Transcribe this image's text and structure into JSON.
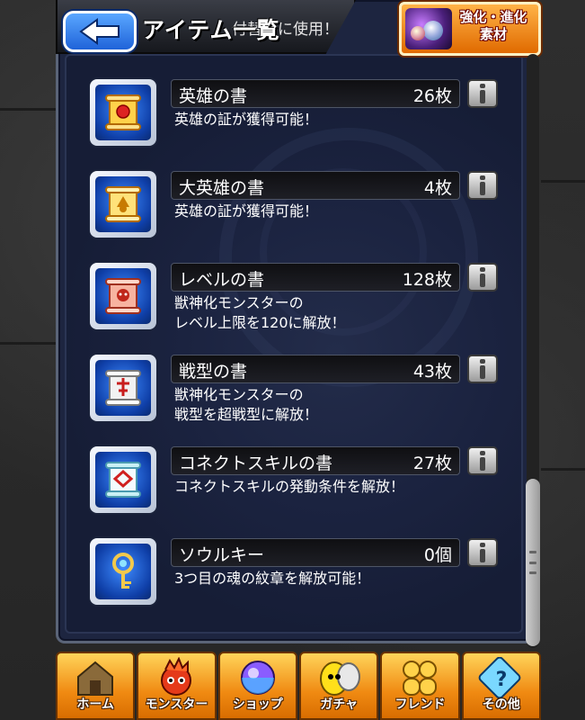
{
  "header": {
    "title": "アイテム一覧",
    "back_label": "back",
    "partial_text": "付替えに使用！"
  },
  "material_button": {
    "label": "強化・進化素材"
  },
  "items": [
    {
      "name": "英雄の書",
      "count": "26枚",
      "desc": [
        "英雄の証が獲得可能！"
      ],
      "icon": "hero-scroll-icon"
    },
    {
      "name": "大英雄の書",
      "count": "4枚",
      "desc": [
        "英雄の証が獲得可能！"
      ],
      "icon": "great-hero-scroll-icon"
    },
    {
      "name": "レベルの書",
      "count": "128枚",
      "desc": [
        "獣神化モンスターの",
        "レベル上限を120に解放！"
      ],
      "icon": "level-scroll-icon"
    },
    {
      "name": "戦型の書",
      "count": "43枚",
      "desc": [
        "獣神化モンスターの",
        "戦型を超戦型に解放！"
      ],
      "icon": "battle-type-scroll-icon"
    },
    {
      "name": "コネクトスキルの書",
      "count": "27枚",
      "desc": [
        "コネクトスキルの発動条件を解放！"
      ],
      "icon": "connect-skill-scroll-icon"
    },
    {
      "name": "ソウルキー",
      "count": "0個",
      "desc": [
        "3つ目の魂の紋章を解放可能！"
      ],
      "icon": "soul-key-icon"
    }
  ],
  "nav": [
    {
      "label": "ホーム",
      "icon": "home-icon"
    },
    {
      "label": "モンスター",
      "icon": "monster-icon"
    },
    {
      "label": "ショップ",
      "icon": "shop-icon"
    },
    {
      "label": "ガチャ",
      "icon": "gacha-icon"
    },
    {
      "label": "フレンド",
      "icon": "friend-icon"
    },
    {
      "label": "その他",
      "icon": "other-icon"
    }
  ],
  "colors": {
    "panel": "#1d2540",
    "accent_orange": "#f08a12",
    "back_blue": "#1f63d9"
  }
}
